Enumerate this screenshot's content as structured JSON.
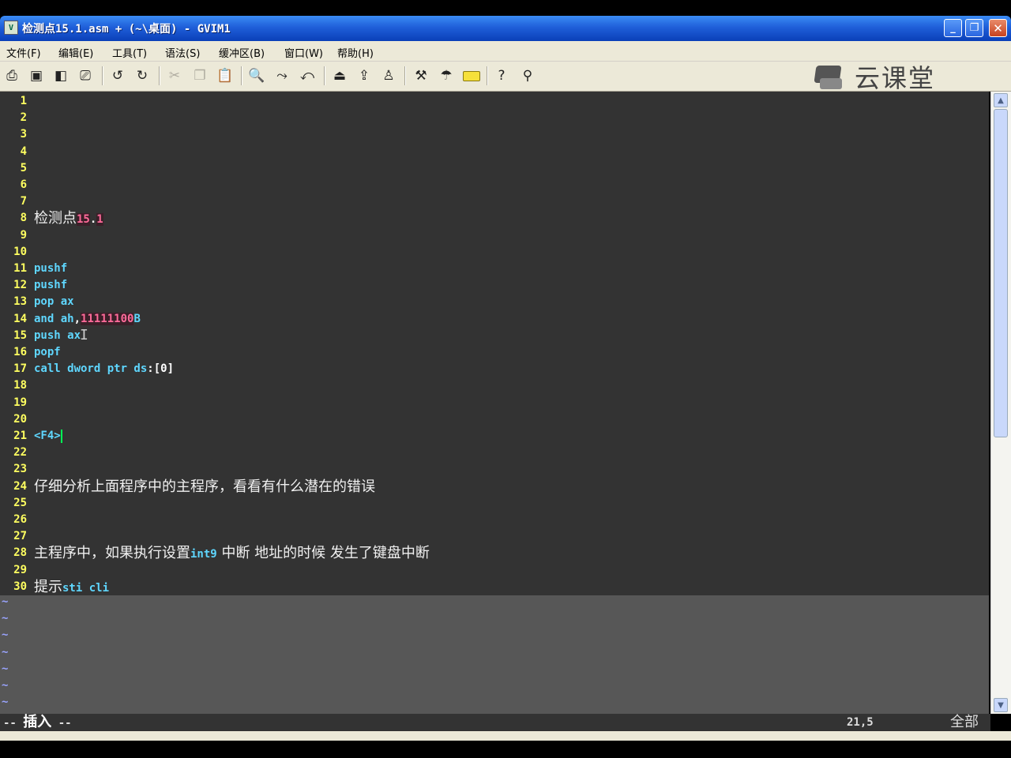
{
  "window": {
    "title": "检测点15.1.asm + (~\\桌面) - GVIM1",
    "icon": "vim-icon",
    "controls": {
      "minimize": "_",
      "maximize": "❐",
      "close": "✕"
    }
  },
  "menu": [
    "文件(F)",
    "编辑(E)",
    "工具(T)",
    "语法(S)",
    "缓冲区(B)",
    "窗口(W)",
    "帮助(H)"
  ],
  "toolbar": {
    "icons": [
      "open-icon",
      "save-icon",
      "save-all-icon",
      "print-icon",
      "undo-icon",
      "redo-icon",
      "cut-icon",
      "copy-icon",
      "paste-icon",
      "find-icon",
      "find-next-icon",
      "find-prev-icon",
      "load-session-icon",
      "save-session-icon",
      "run-script-icon",
      "make-icon",
      "run-ctags-icon",
      "jump-tag-icon",
      "help-icon",
      "find-help-icon"
    ]
  },
  "brand": {
    "text": "云课堂"
  },
  "editor": {
    "lines": [
      {
        "n": "1",
        "parts": []
      },
      {
        "n": "2",
        "parts": []
      },
      {
        "n": "3",
        "parts": []
      },
      {
        "n": "4",
        "parts": []
      },
      {
        "n": "5",
        "parts": []
      },
      {
        "n": "6",
        "parts": []
      },
      {
        "n": "7",
        "parts": []
      },
      {
        "n": "8",
        "parts": [
          {
            "t": "检测点",
            "c": "cjk"
          },
          {
            "t": "15",
            "c": "num-hl"
          },
          {
            "t": ".",
            "c": "sym"
          },
          {
            "t": "1",
            "c": "num-hl"
          }
        ]
      },
      {
        "n": "9",
        "parts": []
      },
      {
        "n": "10",
        "parts": []
      },
      {
        "n": "11",
        "parts": [
          {
            "t": "pushf",
            "c": "kw"
          }
        ]
      },
      {
        "n": "12",
        "parts": [
          {
            "t": "pushf",
            "c": "kw"
          }
        ]
      },
      {
        "n": "13",
        "parts": [
          {
            "t": "pop ax",
            "c": "kw"
          }
        ]
      },
      {
        "n": "14",
        "parts": [
          {
            "t": "and ah",
            "c": "kw"
          },
          {
            "t": ",",
            "c": "sym"
          },
          {
            "t": "11111100",
            "c": "num-hl"
          },
          {
            "t": "B",
            "c": "kw"
          }
        ]
      },
      {
        "n": "15",
        "parts": [
          {
            "t": "push ax",
            "c": "kw"
          }
        ]
      },
      {
        "n": "16",
        "parts": [
          {
            "t": "popf",
            "c": "kw"
          }
        ]
      },
      {
        "n": "17",
        "parts": [
          {
            "t": "call dword ptr ds",
            "c": "kw"
          },
          {
            "t": ":[0]",
            "c": "sym"
          }
        ]
      },
      {
        "n": "18",
        "parts": []
      },
      {
        "n": "19",
        "parts": []
      },
      {
        "n": "20",
        "parts": []
      },
      {
        "n": "21",
        "parts": [
          {
            "t": "<F4>",
            "c": "kw"
          }
        ],
        "cursor": true
      },
      {
        "n": "22",
        "parts": []
      },
      {
        "n": "23",
        "parts": []
      },
      {
        "n": "24",
        "parts": [
          {
            "t": "仔细分析上面程序中的主程序，看看有什么潜在的错误",
            "c": "cjk"
          }
        ]
      },
      {
        "n": "25",
        "parts": []
      },
      {
        "n": "26",
        "parts": []
      },
      {
        "n": "27",
        "parts": []
      },
      {
        "n": "28",
        "parts": [
          {
            "t": "主程序中，如果执行设置",
            "c": "cjk"
          },
          {
            "t": "int9",
            "c": "kw"
          },
          {
            "t": " 中断 地址的时候 发生了键盘中断",
            "c": "cjk"
          }
        ]
      },
      {
        "n": "29",
        "parts": []
      },
      {
        "n": "30",
        "parts": [
          {
            "t": "提示",
            "c": "cjk"
          },
          {
            "t": "sti cli",
            "c": "kw"
          }
        ]
      }
    ],
    "tilde_lines": 7,
    "tilde": "~"
  },
  "status": {
    "mode_prefix": "-- ",
    "mode": "插入",
    "mode_suffix": " --",
    "position": "21,5",
    "scroll": "全部"
  },
  "colors": {
    "bg": "#333333",
    "line_number": "#ffff60",
    "keyword": "#5fd7ff",
    "number": "#ff6b9a",
    "cursor": "#00ff55"
  }
}
